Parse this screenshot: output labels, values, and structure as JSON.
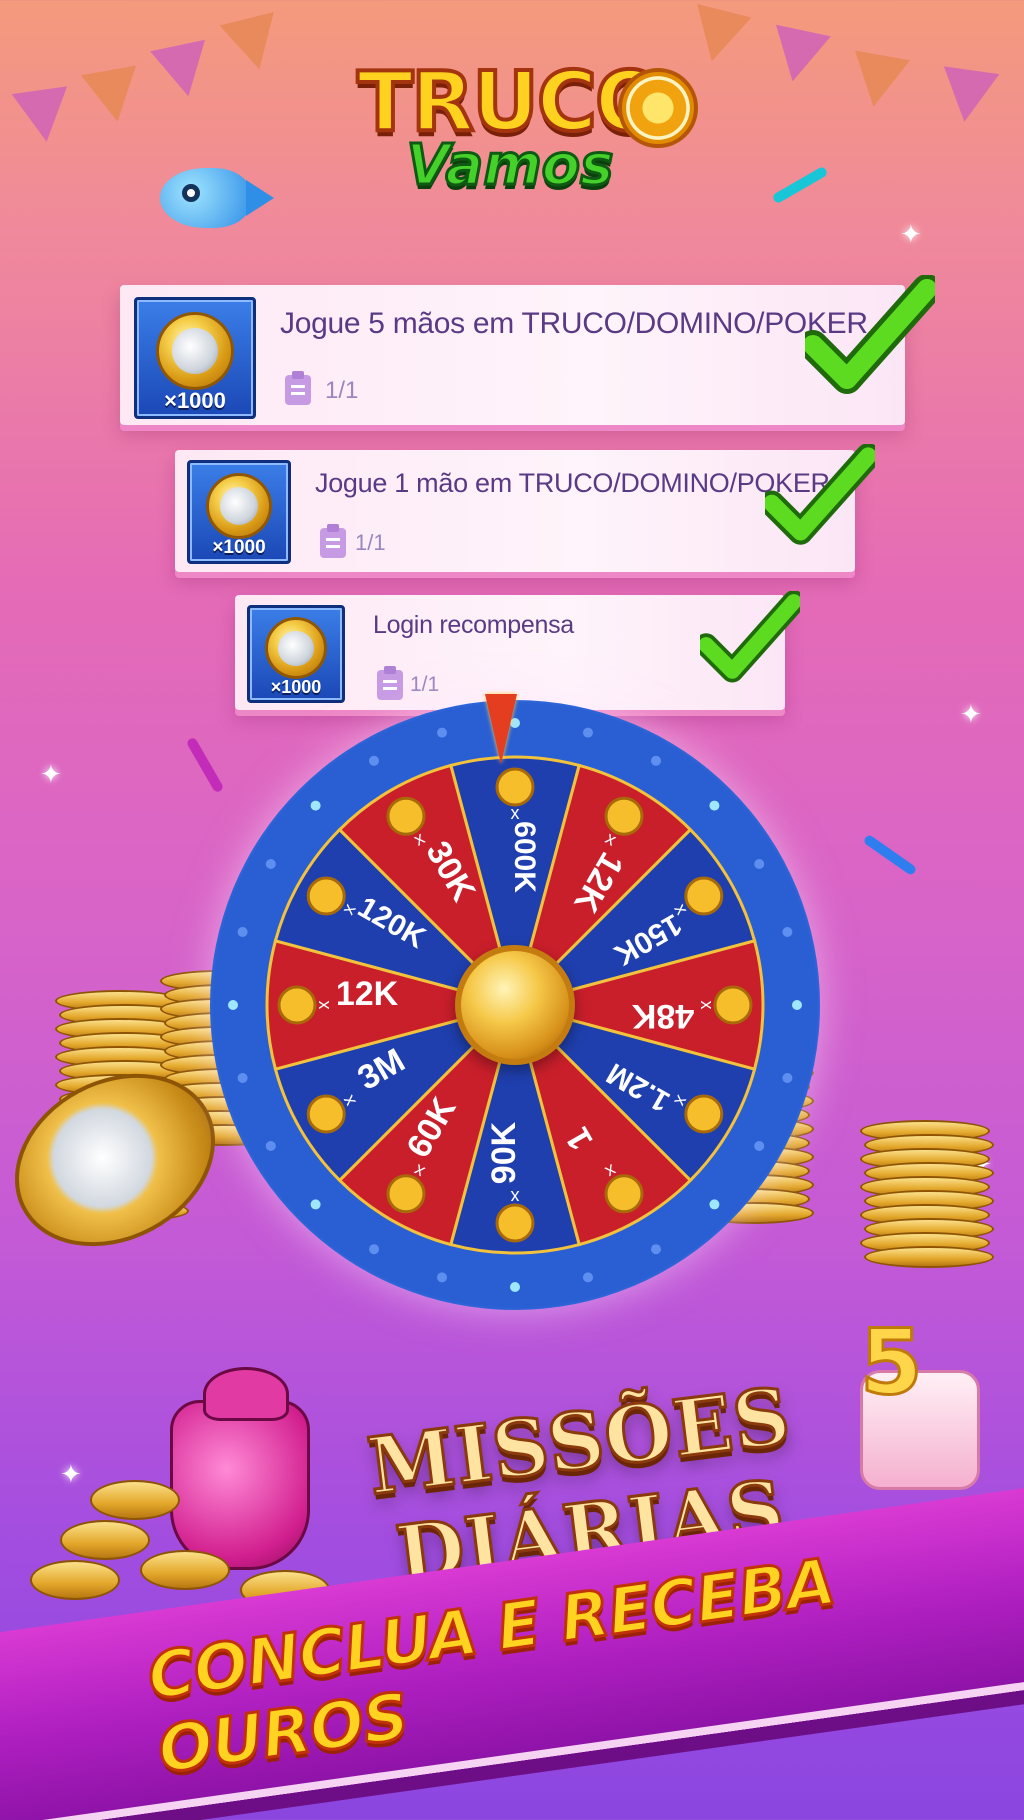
{
  "logo": {
    "line1": "TRUCO",
    "line2": "Vamos"
  },
  "missions": [
    {
      "title": "Jogue 5 mãos em TRUCO/DOMINO/POKER",
      "progress": "1/1",
      "reward": "×1000",
      "completed": true
    },
    {
      "title": "Jogue 1 mão em TRUCO/DOMINO/POKER",
      "progress": "1/1",
      "reward": "×1000",
      "completed": true
    },
    {
      "title": "Login recompensa",
      "progress": "1/1",
      "reward": "×1000",
      "completed": true
    }
  ],
  "wheel": {
    "segments": [
      {
        "label": "600K",
        "multiplier": "x",
        "color": "#1f3fae"
      },
      {
        "label": "12K",
        "multiplier": "x",
        "color": "#c91f2b"
      },
      {
        "label": "150K",
        "multiplier": "x",
        "color": "#1f3fae"
      },
      {
        "label": "48K",
        "multiplier": "x",
        "color": "#c91f2b"
      },
      {
        "label": "1.2M",
        "multiplier": "x",
        "color": "#1f3fae"
      },
      {
        "label": "1",
        "multiplier": "x",
        "color": "#c91f2b"
      },
      {
        "label": "90K",
        "multiplier": "x",
        "color": "#1f3fae"
      },
      {
        "label": "60K",
        "multiplier": "x",
        "color": "#c91f2b"
      },
      {
        "label": "3M",
        "multiplier": "x",
        "color": "#1f3fae"
      },
      {
        "label": "12K",
        "multiplier": "x",
        "color": "#c91f2b"
      },
      {
        "label": "120K",
        "multiplier": "x",
        "color": "#1f3fae"
      },
      {
        "label": "30K",
        "multiplier": "x",
        "color": "#c91f2b"
      }
    ]
  },
  "banner": {
    "headline": "MISSÕES DIÁRIAS",
    "subline": "CONCLUA E RECEBA OUROS",
    "candle": "5"
  },
  "colors": {
    "accent_gold": "#ffd31f",
    "check_green": "#4ccf1a",
    "card_bg": "#fdeaf6"
  }
}
